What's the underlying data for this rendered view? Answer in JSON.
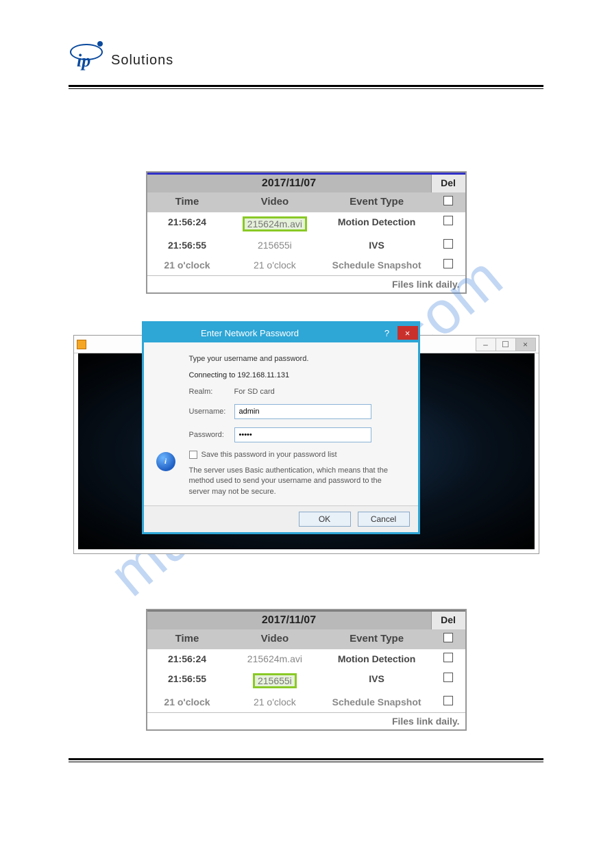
{
  "watermark": "manualshive.com",
  "brand": {
    "logo_text": "Solutions",
    "logo_ip": "ip"
  },
  "tables": {
    "date_label": "2017/11/07",
    "del_label": "Del",
    "columns": {
      "time": "Time",
      "video": "Video",
      "event": "Event Type"
    },
    "footer": "Files link daily.",
    "table1": {
      "rows": [
        {
          "time": "21:56:24",
          "video": "215624m.avi",
          "event": "Motion Detection",
          "highlight": true,
          "grey": false
        },
        {
          "time": "21:56:55",
          "video": "215655i",
          "event": "IVS",
          "highlight": false,
          "grey": false
        },
        {
          "time": "21 o'clock",
          "video": "21 o'clock",
          "event": "Schedule Snapshot",
          "highlight": false,
          "grey": true
        }
      ]
    },
    "table2": {
      "rows": [
        {
          "time": "21:56:24",
          "video": "215624m.avi",
          "event": "Motion Detection",
          "highlight": false,
          "grey": false
        },
        {
          "time": "21:56:55",
          "video": "215655i",
          "event": "IVS",
          "highlight": true,
          "grey": false
        },
        {
          "time": "21 o'clock",
          "video": "21 o'clock",
          "event": "Schedule Snapshot",
          "highlight": false,
          "grey": true
        }
      ]
    }
  },
  "player": {
    "win_buttons": {
      "minimize": "–",
      "maximize": "☐",
      "close": "×"
    }
  },
  "auth": {
    "title": "Enter Network Password",
    "help": "?",
    "close": "×",
    "type_text": "Type your username and password.",
    "connecting": "Connecting to 192.168.11.131",
    "realm_label": "Realm:",
    "realm_value": "For SD card",
    "username_label": "Username:",
    "username_value": "admin",
    "password_label": "Password:",
    "password_value": "•••••",
    "save_pw": "Save this password in your password list",
    "note": "The server uses Basic authentication, which means that the method used to send your username and password to the server may not be secure.",
    "info_glyph": "i",
    "ok": "OK",
    "cancel": "Cancel"
  }
}
